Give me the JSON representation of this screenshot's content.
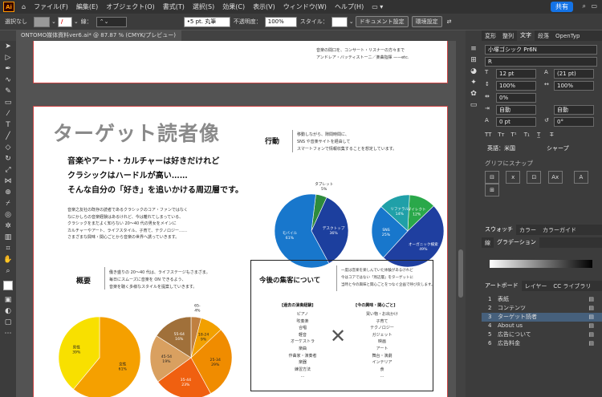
{
  "app": {
    "logo": "Ai",
    "menus": [
      "ファイル(F)",
      "編集(E)",
      "オブジェクト(O)",
      "書式(T)",
      "選択(S)",
      "効果(C)",
      "表示(V)",
      "ウィンドウ(W)",
      "ヘルプ(H)"
    ],
    "share_label": "共有"
  },
  "control": {
    "selection": "選択なし",
    "stroke_label": "線：",
    "brush": "5 pt. 丸筆",
    "opacity_label": "不透明度：",
    "opacity": "100%",
    "style_label": "スタイル：",
    "doc_setup": "ドキュメント設定",
    "prefs": "環境設定"
  },
  "doc_tab": {
    "title": "ONTOMO媒体資料ver6.ai* @ 87.87 % (CMYK/プレビュー)"
  },
  "top_artboard": {
    "line1": "音楽の間口を、コンサート・リスナーの方々まで",
    "line2": "アンドレア・バッティストーニ／楽曲指揮 ——etc."
  },
  "page": {
    "title": "ターゲット読者像",
    "lead1": "音楽やアート・カルチャーは好きだけれど",
    "lead2": "クラシックはハードルが高い……",
    "lead3": "そんな自分の「好き」を追いかける周辺層です。",
    "body": [
      "音楽之友社の既存の読者であるクラシックのコア・ファンではなく",
      "なにかしらの音楽経験はあるけれど、今は離れてしまっている、",
      "クラシックをまだよく知らない 20〜40 代の男女をメインに",
      "カルチャーやアート、ライフスタイル、子育て、テクノロジー……",
      "さまざまな興味・関心ごとから音楽の世界へ誘っていきます。"
    ],
    "behavior_heading": "行動",
    "behavior_text": [
      "移動しながら、隙間時間に、",
      "SNS や音楽サイトを経由して",
      "スマートフォンで情報収集することを想定しています。"
    ],
    "profile_heading": "概要",
    "profile_text": [
      "働き盛りの 20〜40 代は、ライフステージもさまざま。",
      "毎日にスムーズに音楽を ON できるよう、",
      "音楽を聴く多様なスタイルを提案していきます。"
    ],
    "future_heading": "今後の集客について",
    "future_text": [
      "一度は音楽を楽しんでいた体験があるけれど",
      "今はコアではない「周辺層」をターゲットに",
      "当時と今の興味と関心ごとをつなぐ企画で呼び戻します。"
    ],
    "past_heading": "[過去の演奏経験]",
    "past_items": [
      "ピアノ",
      "吹奏楽",
      "合唱",
      "軽音",
      "オーケストラ",
      "楽曲",
      "作曲家・演奏者",
      "楽器",
      "練習方法",
      "…"
    ],
    "now_heading": "[今の興味・関心ごと]",
    "now_items": [
      "買い物・お出かけ",
      "子育て",
      "テクノロジー",
      "ガジェット",
      "映画",
      "アート",
      "舞台・演劇",
      "インテリア",
      "食",
      "…"
    ]
  },
  "chart_data": [
    {
      "type": "pie",
      "title": "",
      "slices": [
        {
          "label": "タブレット",
          "value": 5,
          "color": "#2e8b3d"
        },
        {
          "label": "デスクトップ",
          "value": 36,
          "color": "#1c3f9e"
        },
        {
          "label": "モバイル",
          "value": 61,
          "color": "#1877cc"
        }
      ]
    },
    {
      "type": "pie",
      "title": "",
      "slices": [
        {
          "label": "ダイレクト",
          "value": 12,
          "color": "#2aa84a"
        },
        {
          "label": "オーガニック検索",
          "value": 49,
          "color": "#1f3fa0"
        },
        {
          "label": "SNS",
          "value": 25,
          "color": "#1877cc"
        },
        {
          "label": "リファラル",
          "value": 14,
          "color": "#20a0a8"
        }
      ]
    },
    {
      "type": "pie",
      "title": "",
      "slices": [
        {
          "label": "女性",
          "value": 61,
          "color": "#f5a000"
        },
        {
          "label": "男性",
          "value": 39,
          "color": "#f8e000"
        }
      ]
    },
    {
      "type": "pie",
      "title": "",
      "slices": [
        {
          "label": "65-",
          "value": 4,
          "color": "#c08040"
        },
        {
          "label": "18-24",
          "value": 9,
          "color": "#f2a000"
        },
        {
          "label": "25-34",
          "value": 29,
          "color": "#f08c00"
        },
        {
          "label": "35-44",
          "value": 23,
          "color": "#f06010"
        },
        {
          "label": "45-54",
          "value": 19,
          "color": "#d9a060"
        },
        {
          "label": "55-64",
          "value": 16,
          "color": "#a0703a"
        }
      ]
    }
  ],
  "panels": {
    "tabs_top": [
      "変形",
      "整列",
      "文字",
      "段落",
      "OpenTyp"
    ],
    "font": "小塚ゴシック Pr6N",
    "weight": "R",
    "size": "12 pt",
    "leading": "(21 pt)",
    "vscale": "100%",
    "hscale": "100%",
    "tsume": "0%",
    "auto1": "自動",
    "auto2": "自動",
    "baseline": "0 pt",
    "rotate": "0°",
    "lang": "英語：米国",
    "aa": "シャープ",
    "glyph_snap": "グリフにスナップ",
    "tabs_mid": [
      "スウォッチ",
      "カラー",
      "カラーガイド"
    ],
    "tabs_grad": [
      "線",
      "グラデーション"
    ],
    "tabs_layers": [
      "アートボード",
      "レイヤー",
      "CC ライブラリ"
    ],
    "artboards": [
      {
        "num": "1",
        "name": "表紙"
      },
      {
        "num": "2",
        "name": "コンテンツ"
      },
      {
        "num": "3",
        "name": "ターゲット読者"
      },
      {
        "num": "4",
        "name": "About us"
      },
      {
        "num": "5",
        "name": "広告について"
      },
      {
        "num": "6",
        "name": "広告料金"
      }
    ]
  }
}
